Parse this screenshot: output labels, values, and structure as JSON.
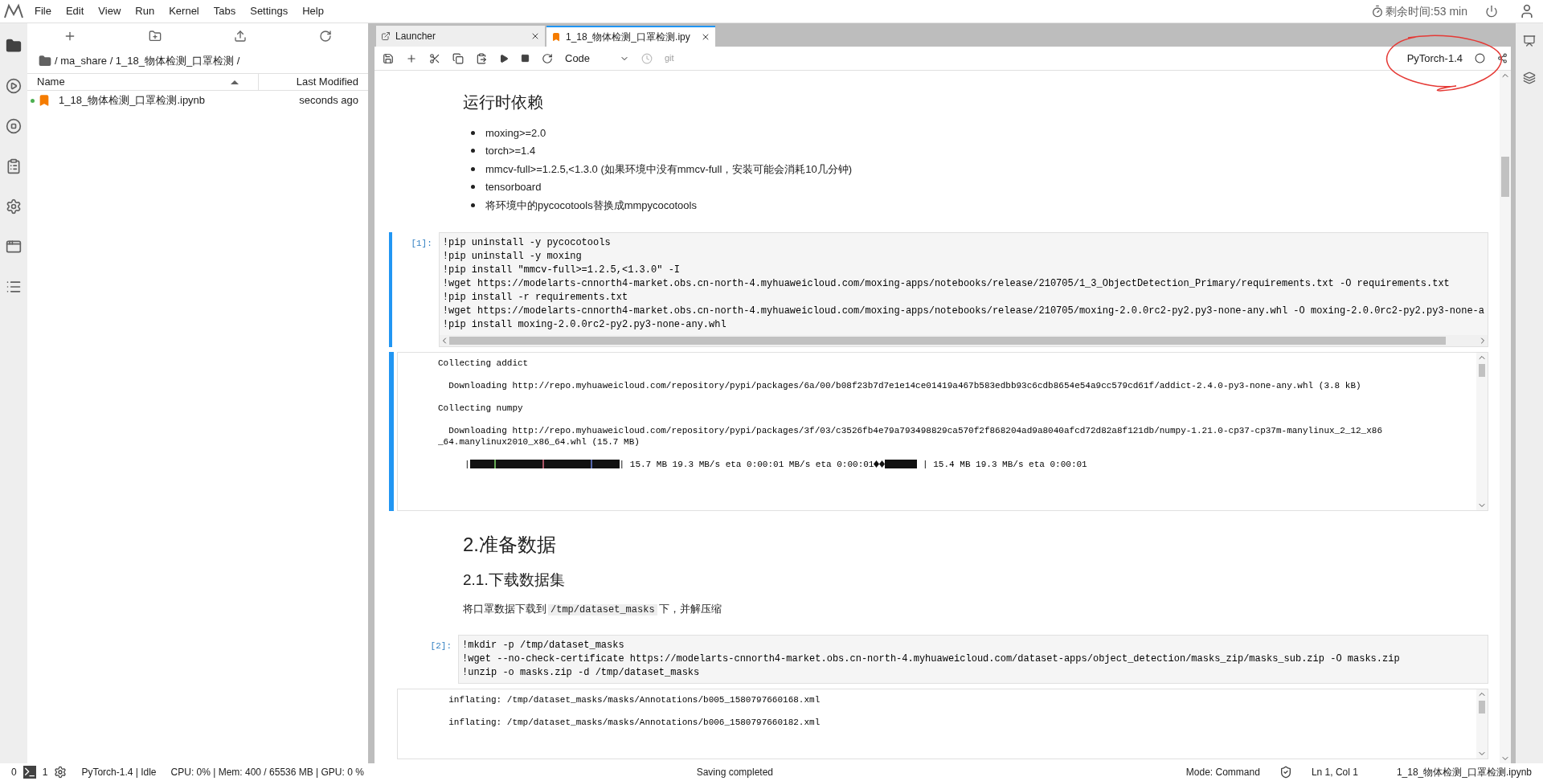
{
  "menu": [
    "File",
    "Edit",
    "View",
    "Run",
    "Kernel",
    "Tabs",
    "Settings",
    "Help"
  ],
  "timer": "剩余时间:53 min",
  "file_browser": {
    "breadcrumb": "/ ma_share / 1_18_物体检测_口罩检测 /",
    "columns": [
      "Name",
      "Last Modified"
    ],
    "files": [
      {
        "name": "1_18_物体检测_口罩检测.ipynb",
        "modified": "seconds ago",
        "running": true
      }
    ]
  },
  "tabs": [
    {
      "label": "Launcher",
      "selected": false
    },
    {
      "label": "1_18_物体检测_口罩检测.ipy",
      "selected": true
    }
  ],
  "toolbar": {
    "cell_type": "Code",
    "git": "git",
    "kernel": "PyTorch-1.4"
  },
  "cells": [
    {
      "kind": "markdown",
      "heading": "运行时依赖",
      "bullets": [
        "moxing>=2.0",
        "torch>=1.4",
        "mmcv-full>=1.2.5,<1.3.0 (如果环境中没有mmcv-full，安装可能会消耗10几分钟)",
        "tensorboard",
        "将环境中的pycocotools替换成mmpycocotools"
      ]
    },
    {
      "kind": "code",
      "prompt": "[1]:",
      "selected": true,
      "lines": [
        "!pip uninstall -y pycocotools",
        "!pip uninstall -y moxing",
        "!pip install \"mmcv-full>=1.2.5,<1.3.0\" -I",
        "!wget https://modelarts-cnnorth4-market.obs.cn-north-4.myhuaweicloud.com/moxing-apps/notebooks/release/210705/1_3_ObjectDetection_Primary/requirements.txt -O requirements.txt",
        "!pip install -r requirements.txt",
        "!wget https://modelarts-cnnorth4-market.obs.cn-north-4.myhuaweicloud.com/moxing-apps/notebooks/release/210705/moxing-2.0.0rc2-py2.py3-none-any.whl -O moxing-2.0.0rc2-py2.py3-none-a",
        "!pip install moxing-2.0.0rc2-py2.py3-none-any.whl"
      ],
      "output": [
        {
          "kind": "text",
          "text": "Collecting addict"
        },
        {
          "kind": "text",
          "text": "  Downloading http://repo.myhuaweicloud.com/repository/pypi/packages/6a/00/b08f23b7d7e1e14ce01419a467b583edbb93c6cdb8654e54a9cc579cd61f/addict-2.4.0-py3-none-any.whl (3.8 kB)"
        },
        {
          "kind": "text",
          "text": "Collecting numpy"
        },
        {
          "kind": "text",
          "text": "  Downloading http://repo.myhuaweicloud.com/repository/pypi/packages/3f/03/c3526fb4e79a793498829ca570f2f868204ad9a8040afcd72d82a8f121db/numpy-1.21.0-cp37-cp37m-manylinux_2_12_x86"
        },
        {
          "kind": "continuation",
          "text": "_64.manylinux2010_x86_64.whl (15.7 MB)"
        },
        {
          "kind": "progress",
          "start": "     |",
          "middle": "| 15.7 MB 19.3 MB/s eta 0:00:01 MB/s eta 0:00:01",
          "end": "| 15.4 MB 19.3 MB/s eta 0:00:01"
        }
      ]
    },
    {
      "kind": "markdown",
      "heading": "2.准备数据",
      "subheading": "2.1.下载数据集",
      "paragraph": {
        "before": "将口罩数据下载到",
        "code": "/tmp/dataset_masks",
        "after": "下，并解压缩"
      }
    },
    {
      "kind": "code",
      "prompt": "[2]:",
      "selected": false,
      "lines": [
        "!mkdir -p /tmp/dataset_masks",
        "!wget --no-check-certificate https://modelarts-cnnorth4-market.obs.cn-north-4.myhuaweicloud.com/dataset-apps/object_detection/masks_zip/masks_sub.zip -O masks.zip",
        "!unzip -o masks.zip -d /tmp/dataset_masks"
      ],
      "output": [
        {
          "kind": "text",
          "text": "  inflating: /tmp/dataset_masks/masks/Annotations/b005_1580797660168.xml"
        },
        {
          "kind": "text",
          "text": "  inflating: /tmp/dataset_masks/masks/Annotations/b006_1580797660182.xml"
        }
      ]
    }
  ],
  "status_bar": {
    "terminals": "0",
    "kernels": "1",
    "kernel_status": "PyTorch-1.4 | Idle",
    "resources": "CPU: 0% | Mem: 400 / 65536 MB | GPU: 0 %",
    "message": "Saving completed",
    "mode": "Mode: Command",
    "position": "Ln 1, Col 1",
    "file": "1_18_物体检测_口罩检测.ipynb"
  }
}
